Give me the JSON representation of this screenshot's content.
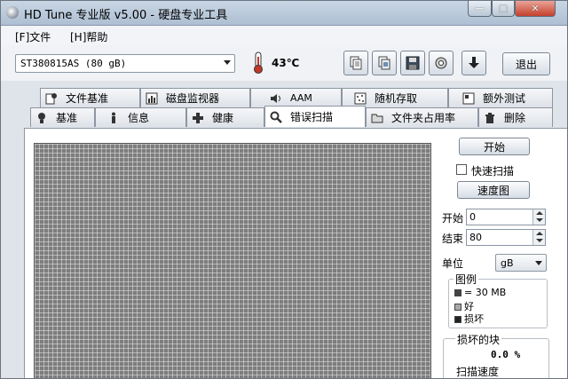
{
  "window": {
    "title": "HD Tune 专业版 v5.00 - 硬盘专业工具",
    "min": "—",
    "max": "□",
    "close": "✕"
  },
  "menu": {
    "file": "[F]文件",
    "help": "[H]帮助"
  },
  "toolbar": {
    "drive": "ST380815AS (80 gB)",
    "temperature": "43℃",
    "exit_label": "退出",
    "buttons": [
      "copy-text-icon",
      "copy-image-icon",
      "save-icon",
      "options-icon",
      "download-icon"
    ]
  },
  "tabs": {
    "row1": [
      {
        "label": "文件基准",
        "icon": "file-benchmark-icon"
      },
      {
        "label": "磁盘监视器",
        "icon": "disk-monitor-icon"
      },
      {
        "label": "AAM",
        "icon": "speaker-icon"
      },
      {
        "label": "随机存取",
        "icon": "random-access-icon"
      },
      {
        "label": "额外测试",
        "icon": "extra-tests-icon"
      }
    ],
    "row2": [
      {
        "label": "基准",
        "icon": "benchmark-icon"
      },
      {
        "label": "信息",
        "icon": "info-icon"
      },
      {
        "label": "健康",
        "icon": "health-icon"
      },
      {
        "label": "错误扫描",
        "icon": "error-scan-icon",
        "active": true
      },
      {
        "label": "文件夹占用率",
        "icon": "folder-usage-icon"
      },
      {
        "label": "删除",
        "icon": "erase-icon"
      }
    ]
  },
  "scan": {
    "start_button": "开始",
    "quick_scan_label": "快速扫描",
    "quick_scan_checked": false,
    "speed_map_button": "速度图",
    "start_label": "开始",
    "start_value": "0",
    "end_label": "结束",
    "end_value": "80",
    "unit_label": "单位",
    "unit_value": "gB",
    "legend": {
      "title": "图例",
      "block_size": "= 30 MB",
      "good": "好",
      "damaged": "损坏"
    },
    "damaged_blocks": {
      "title": "损坏的块",
      "value": "0.0 %",
      "scan_speed_label": "扫描速度"
    }
  },
  "colors": {
    "block_good": "#8a8a8a",
    "block_damaged": "#222222",
    "accent": "#aebfd3"
  }
}
